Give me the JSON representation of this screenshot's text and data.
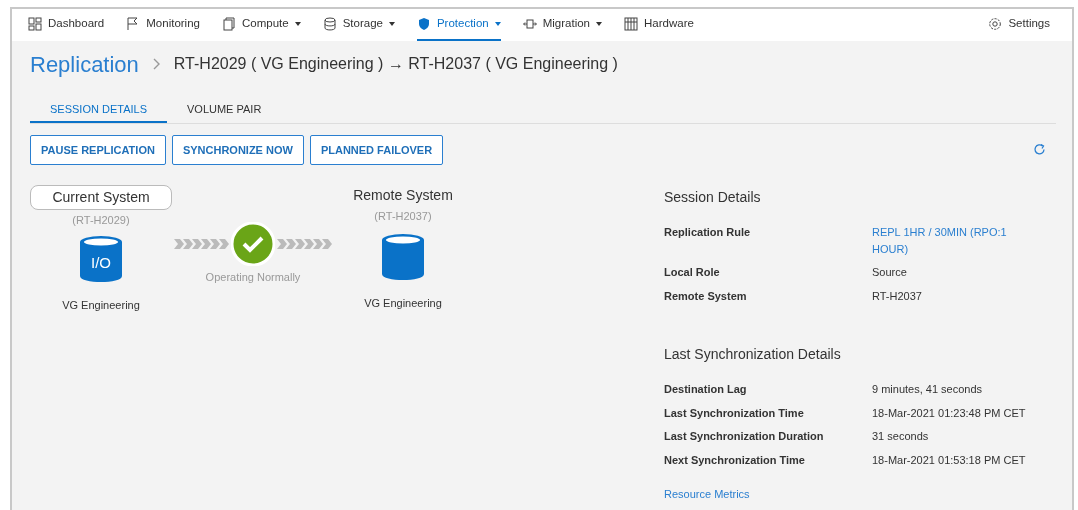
{
  "nav": {
    "items": [
      {
        "label": "Dashboard",
        "dropdown": false,
        "selected": false
      },
      {
        "label": "Monitoring",
        "dropdown": false,
        "selected": false
      },
      {
        "label": "Compute",
        "dropdown": true,
        "selected": false
      },
      {
        "label": "Storage",
        "dropdown": true,
        "selected": false
      },
      {
        "label": "Protection",
        "dropdown": true,
        "selected": true
      },
      {
        "label": "Migration",
        "dropdown": true,
        "selected": false
      },
      {
        "label": "Hardware",
        "dropdown": false,
        "selected": false
      }
    ],
    "settings": "Settings"
  },
  "breadcrumb": {
    "parent": "Replication",
    "current": "RT-H2029 ( VG Engineering ) → RT-H2037 ( VG Engineering )"
  },
  "tabs": [
    {
      "label": "SESSION DETAILS",
      "selected": true
    },
    {
      "label": "VOLUME PAIR",
      "selected": false
    }
  ],
  "buttons": [
    "PAUSE REPLICATION",
    "SYNCHRONIZE NOW",
    "PLANNED FAILOVER"
  ],
  "diagram": {
    "source": {
      "title": "Current System",
      "id": "(RT-H2029)",
      "volume_label": "I/O",
      "name": "VG Engineering"
    },
    "status": "Operating Normally",
    "target": {
      "title": "Remote System",
      "id": "(RT-H2037)",
      "name": "VG Engineering"
    }
  },
  "session_details": {
    "title": "Session Details",
    "rows": [
      {
        "label": "Replication Rule",
        "value": "REPL 1HR / 30MIN (RPO:1 HOUR)",
        "kind": "link"
      },
      {
        "label": "Local Role",
        "value": "Source",
        "kind": "text"
      },
      {
        "label": "Remote System",
        "value": "RT-H2037",
        "kind": "text"
      }
    ]
  },
  "last_sync": {
    "title": "Last Synchronization Details",
    "rows": [
      {
        "label": "Destination Lag",
        "value": "9 minutes, 41 seconds"
      },
      {
        "label": "Last Synchronization Time",
        "value": "18-Mar-2021 01:23:48 PM CET"
      },
      {
        "label": "Last Synchronization Duration",
        "value": "31 seconds"
      },
      {
        "label": "Next Synchronization Time",
        "value": "18-Mar-2021 01:53:18 PM CET"
      }
    ]
  },
  "resource_link": "Resource Metrics"
}
